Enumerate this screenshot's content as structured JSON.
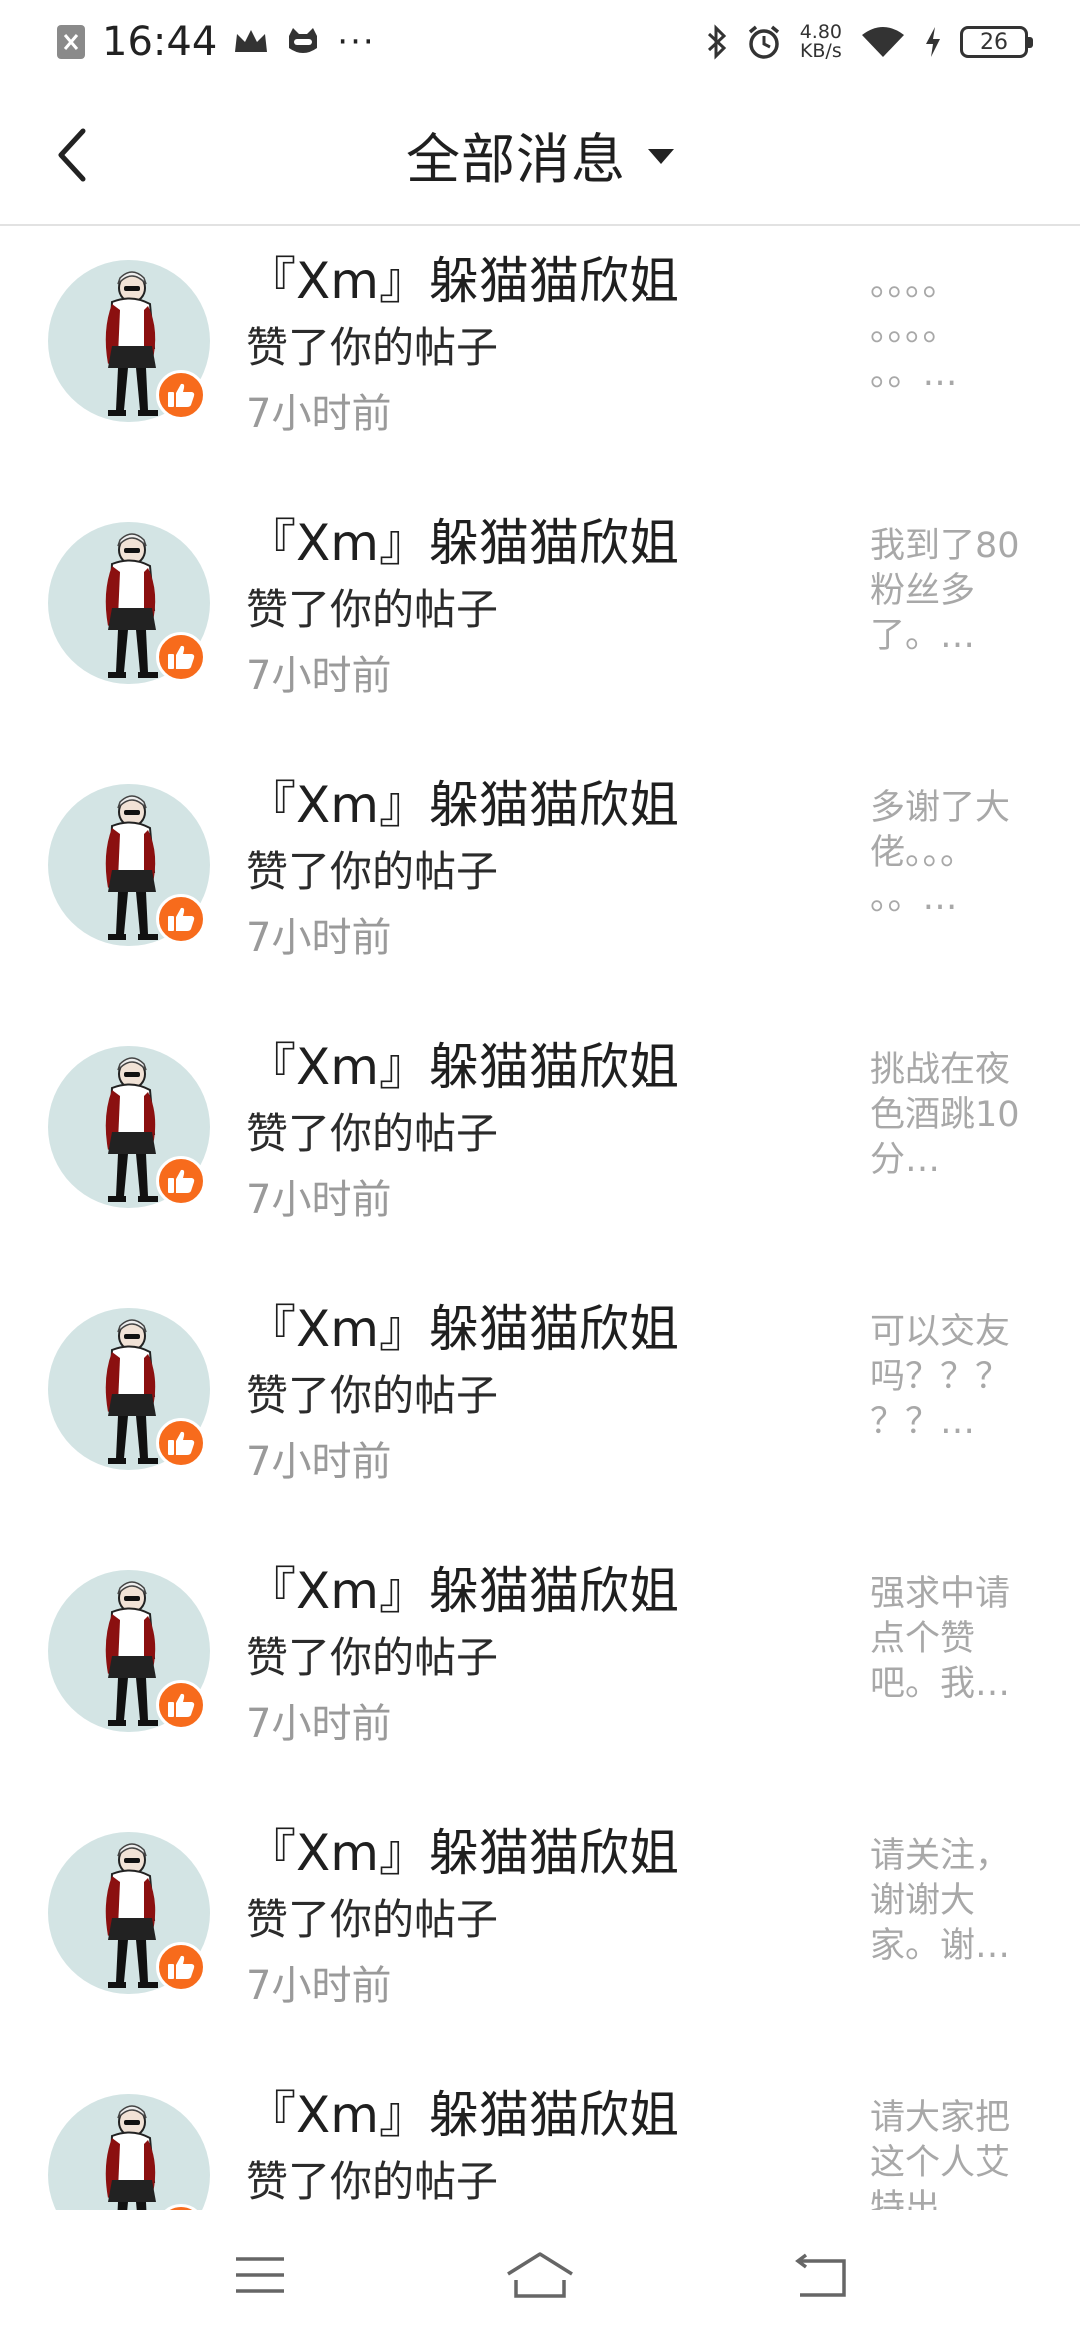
{
  "status_bar": {
    "time": "16:44",
    "more": "···",
    "net_speed_value": "4.80",
    "net_speed_unit": "KB/s",
    "battery_level": "26"
  },
  "header": {
    "title": "全部消息"
  },
  "colors": {
    "like_badge": "#f76b1c",
    "avatar_bg": "#d3e4e4",
    "secondary_text": "#9a9a9a"
  },
  "messages": [
    {
      "name": "『Xm』躲猫猫欣姐",
      "action": "赞了你的帖子",
      "time": "7小时前",
      "snippet": "。。。。\n。。。。\n。。…"
    },
    {
      "name": "『Xm』躲猫猫欣姐",
      "action": "赞了你的帖子",
      "time": "7小时前",
      "snippet": "我到了80\n粉丝多\n了。…"
    },
    {
      "name": "『Xm』躲猫猫欣姐",
      "action": "赞了你的帖子",
      "time": "7小时前",
      "snippet": "多谢了大\n佬。。。\n。。…"
    },
    {
      "name": "『Xm』躲猫猫欣姐",
      "action": "赞了你的帖子",
      "time": "7小时前",
      "snippet": "挑战在夜\n色酒跳10\n分…"
    },
    {
      "name": "『Xm』躲猫猫欣姐",
      "action": "赞了你的帖子",
      "time": "7小时前",
      "snippet": "可以交友\n吗？？？\n？？…"
    },
    {
      "name": "『Xm』躲猫猫欣姐",
      "action": "赞了你的帖子",
      "time": "7小时前",
      "snippet": "强求中请\n点个赞\n吧。我…"
    },
    {
      "name": "『Xm』躲猫猫欣姐",
      "action": "赞了你的帖子",
      "time": "7小时前",
      "snippet": "请关注，\n谢谢大\n家。谢…"
    },
    {
      "name": "『Xm』躲猫猫欣姐",
      "action": "赞了你的帖子",
      "time": "",
      "snippet": "请大家把\n这个人艾\n特出"
    }
  ],
  "icons": {
    "back": "chevron-left-icon",
    "dropdown": "triangle-down-icon",
    "like": "thumbs-up-icon",
    "nav_menu": "menu-icon",
    "nav_home": "home-icon",
    "nav_back": "return-icon"
  }
}
